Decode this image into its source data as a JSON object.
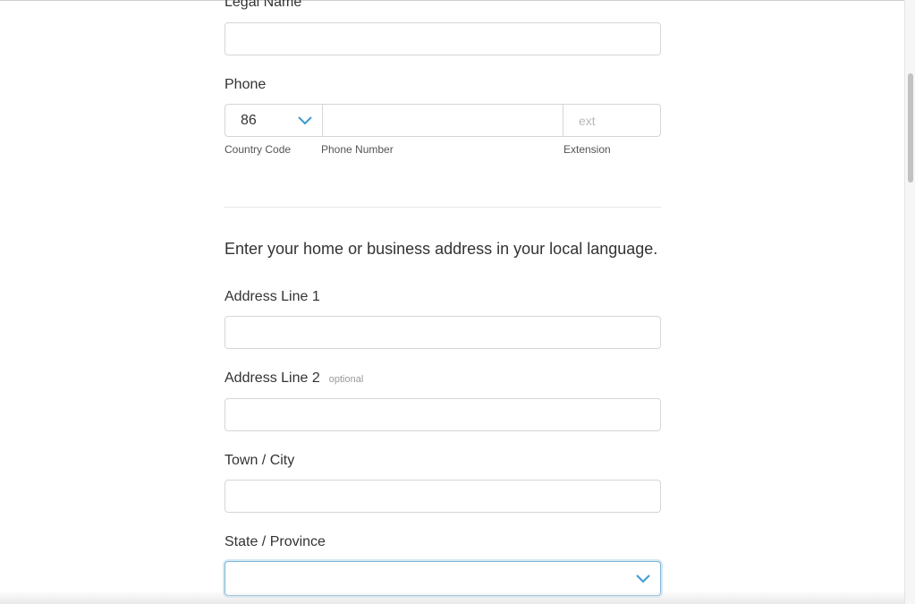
{
  "form": {
    "legal_name": {
      "label": "Legal Name",
      "value": ""
    },
    "phone": {
      "label": "Phone",
      "country_code": {
        "value": "86",
        "caption": "Country Code"
      },
      "number": {
        "value": "",
        "caption": "Phone Number"
      },
      "extension": {
        "value": "",
        "placeholder": "ext",
        "caption": "Extension"
      }
    },
    "address_intro": "Enter your home or business address in your local language.",
    "address_line_1": {
      "label": "Address Line 1",
      "value": ""
    },
    "address_line_2": {
      "label": "Address Line 2",
      "optional": "optional",
      "value": ""
    },
    "town_city": {
      "label": "Town / City",
      "value": ""
    },
    "state_province": {
      "label": "State / Province",
      "value": ""
    }
  },
  "icons": {
    "dropdown": "chevron-down-icon"
  },
  "colors": {
    "accent": "#3a9bd0",
    "focus_border": "#7fb6d6",
    "border": "#d6d6d6",
    "text": "#333333"
  }
}
